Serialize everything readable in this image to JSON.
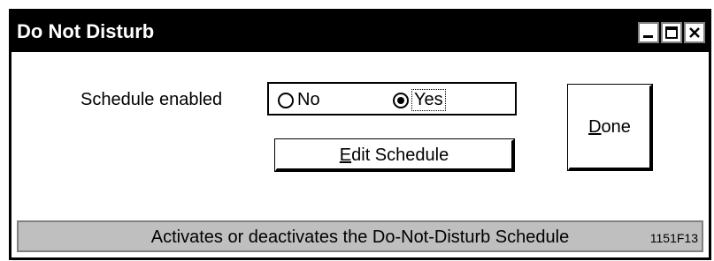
{
  "window": {
    "title": "Do Not Disturb",
    "controls": [
      "minimize-icon",
      "maximize-icon",
      "close-icon"
    ]
  },
  "schedule": {
    "label": "Schedule enabled",
    "options": [
      {
        "label": "No",
        "selected": false
      },
      {
        "label": "Yes",
        "selected": true
      }
    ]
  },
  "buttons": {
    "edit_schedule_mnemonic": "E",
    "edit_schedule_rest": "dit Schedule",
    "done_mnemonic": "D",
    "done_rest": "one"
  },
  "status": {
    "text": "Activates or deactivates the Do-Not-Disturb Schedule"
  },
  "figure_id": "1151F13",
  "colors": {
    "titlebar": "#000000",
    "statusbar": "#bfbfbf",
    "background": "#ffffff"
  }
}
